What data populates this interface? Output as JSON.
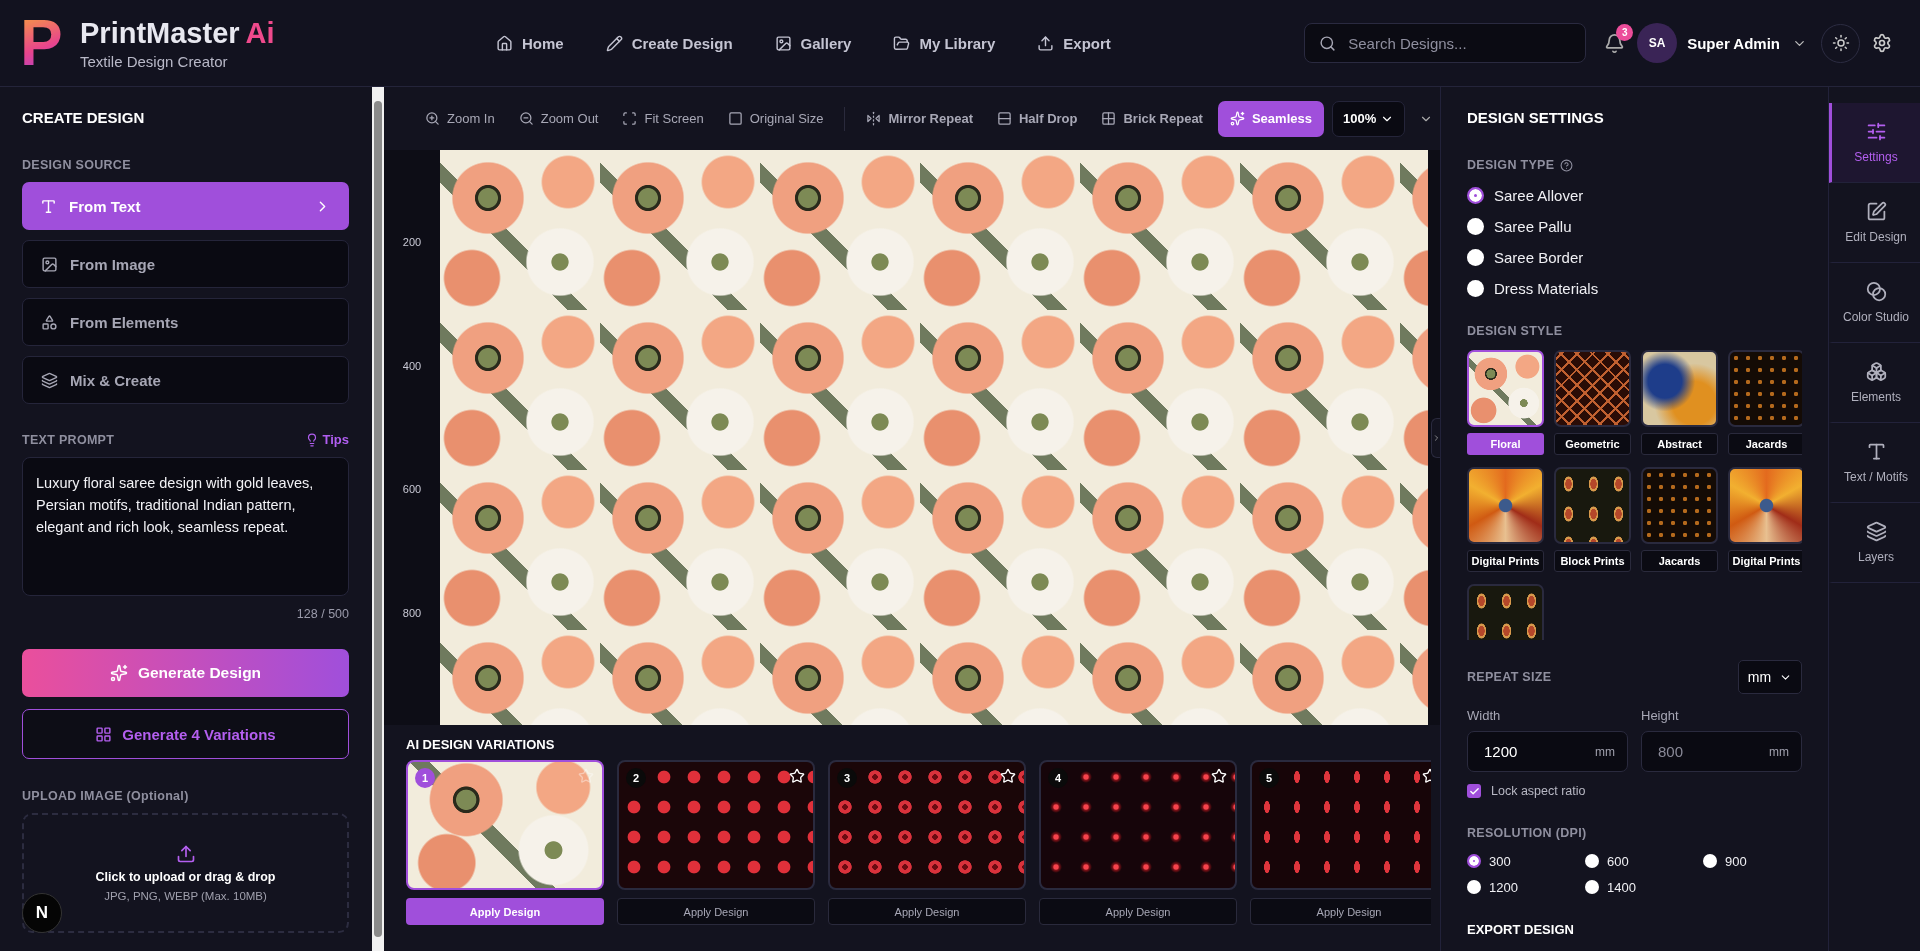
{
  "brand": {
    "logo_letter": "P",
    "name": "PrintMaster",
    "accent": "Ai",
    "tagline": "Textile Design Creator"
  },
  "nav": [
    {
      "label": "Home"
    },
    {
      "label": "Create Design"
    },
    {
      "label": "Gallery"
    },
    {
      "label": "My Library"
    },
    {
      "label": "Export"
    }
  ],
  "search": {
    "placeholder": "Search Designs..."
  },
  "notifications": {
    "count": "3"
  },
  "user": {
    "initials": "SA",
    "name": "Super Admin"
  },
  "create_panel": {
    "title": "CREATE DESIGN",
    "source_label": "DESIGN SOURCE",
    "sources": [
      {
        "label": "From Text",
        "selected": true
      },
      {
        "label": "From Image",
        "selected": false
      },
      {
        "label": "From Elements",
        "selected": false
      },
      {
        "label": "Mix & Create",
        "selected": false
      }
    ],
    "prompt_label": "TEXT PROMPT",
    "tips": "Tips",
    "prompt": "Luxury floral saree design with gold leaves, Persian motifs, traditional Indian pattern, elegant and rich look, seamless repeat.",
    "counter": "128 / 500",
    "generate_button": "Generate Design",
    "variations_button": "Generate 4 Variations",
    "upload_label": "UPLOAD IMAGE (Optional)",
    "upload_text": "Click to upload or drag & drop",
    "upload_hint": "JPG, PNG, WEBP (Max. 10MB)",
    "floating_badge": "N"
  },
  "toolbar": {
    "view_tools": [
      {
        "label": "Zoom In",
        "selected": false
      },
      {
        "label": "Zoom Out",
        "selected": false
      },
      {
        "label": "Fit Screen",
        "selected": false
      },
      {
        "label": "Original Size",
        "selected": false
      }
    ],
    "repeat_tools": [
      {
        "label": "Mirror Repeat",
        "selected": false
      },
      {
        "label": "Half Drop",
        "selected": false
      },
      {
        "label": "Brick Repeat",
        "selected": false
      },
      {
        "label": "Seamless",
        "selected": true
      }
    ],
    "zoom": "100%"
  },
  "ruler": [
    "200",
    "400",
    "600",
    "800"
  ],
  "variations": {
    "title": "AI DESIGN VARIATIONS",
    "items": [
      {
        "number": "1",
        "kind": "floral",
        "selected": true,
        "button": "Apply Design"
      },
      {
        "number": "2",
        "kind": "flowers",
        "selected": false,
        "button": "Apply Design"
      },
      {
        "number": "3",
        "kind": "rings",
        "selected": false,
        "button": "Apply Design"
      },
      {
        "number": "4",
        "kind": "glow",
        "selected": false,
        "button": "Apply Design"
      },
      {
        "number": "5",
        "kind": "drops",
        "selected": false,
        "button": "Apply Design"
      }
    ]
  },
  "settings": {
    "title": "DESIGN SETTINGS",
    "type_label": "DESIGN TYPE",
    "types": [
      {
        "label": "Saree Allover",
        "selected": true
      },
      {
        "label": "Saree Pallu",
        "selected": false
      },
      {
        "label": "Saree Border",
        "selected": false
      },
      {
        "label": "Dress Materials",
        "selected": false
      }
    ],
    "style_label": "DESIGN STYLE",
    "styles": [
      {
        "label": "Floral",
        "kind": "floral",
        "selected": true
      },
      {
        "label": "Geometric",
        "kind": "geometric",
        "selected": false
      },
      {
        "label": "Abstract",
        "kind": "abstract",
        "selected": false
      },
      {
        "label": "Jacards",
        "kind": "jacard",
        "selected": false
      },
      {
        "label": "Digital Prints",
        "kind": "leaves",
        "selected": false
      },
      {
        "label": "Block Prints",
        "kind": "paisley",
        "selected": false
      },
      {
        "label": "Jacards",
        "kind": "jacard",
        "selected": false
      },
      {
        "label": "Digital Prints",
        "kind": "leaves",
        "selected": false
      },
      {
        "kind": "paisley",
        "selected": false
      }
    ],
    "repeat_label": "REPEAT SIZE",
    "unit_select": "mm",
    "width_label": "Width",
    "width_value": "1200",
    "width_unit": "mm",
    "height_label": "Height",
    "height_placeholder": "800",
    "height_unit": "mm",
    "lock": {
      "label": "Lock aspect ratio",
      "checked": true
    },
    "resolution_label": "RESOLUTION (DPI)",
    "dpi": [
      {
        "label": "300",
        "selected": true
      },
      {
        "label": "600",
        "selected": false
      },
      {
        "label": "900",
        "selected": false
      },
      {
        "label": "1200",
        "selected": false
      },
      {
        "label": "1400",
        "selected": false
      }
    ],
    "export_title": "EXPORT DESIGN"
  },
  "rail": [
    {
      "label": "Settings",
      "selected": true
    },
    {
      "label": "Edit Design",
      "selected": false
    },
    {
      "label": "Color Studio",
      "selected": false
    },
    {
      "label": "Elements",
      "selected": false
    },
    {
      "label": "Text / Motifs",
      "selected": false
    },
    {
      "label": "Layers",
      "selected": false
    }
  ]
}
